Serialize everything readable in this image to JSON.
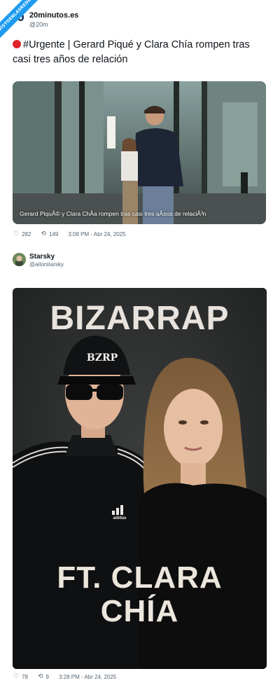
{
  "ribbon": {
    "text": "VISTOENLASREDES"
  },
  "tweet1": {
    "avatar_text": "20",
    "author_name": "20minutos.es",
    "author_handle": "@20m",
    "text": "#Urgente | Gerard Piqué y Clara Chía rompen tras casi tres años de relación",
    "image_caption": "Gerard PiquÃ© y Clara ChÃ­a rompen tras casi tres aÃ±os de relaciÃ³n",
    "likes": "282",
    "retweets": "149",
    "timestamp": "3:08 PM - Abr 24, 2025"
  },
  "tweet2": {
    "author_name": "Starsky",
    "author_handle": "@aitorstarsky",
    "poster_title": "BIZARRAP",
    "cap_text": "BZRP",
    "jacket_logo": "adidas",
    "poster_ft_line1": "FT. CLARA",
    "poster_ft_line2": "CHÍA",
    "likes": "78",
    "retweets": "9",
    "timestamp": "3:28 PM - Abr 24, 2025"
  },
  "colors": {
    "accent": "#1d9bf0",
    "alert_red": "#e0222a",
    "meta_gray": "#536471"
  },
  "icons": {
    "like": "heart-icon",
    "retweet": "retweet-icon",
    "alert": "red-circle-icon"
  }
}
